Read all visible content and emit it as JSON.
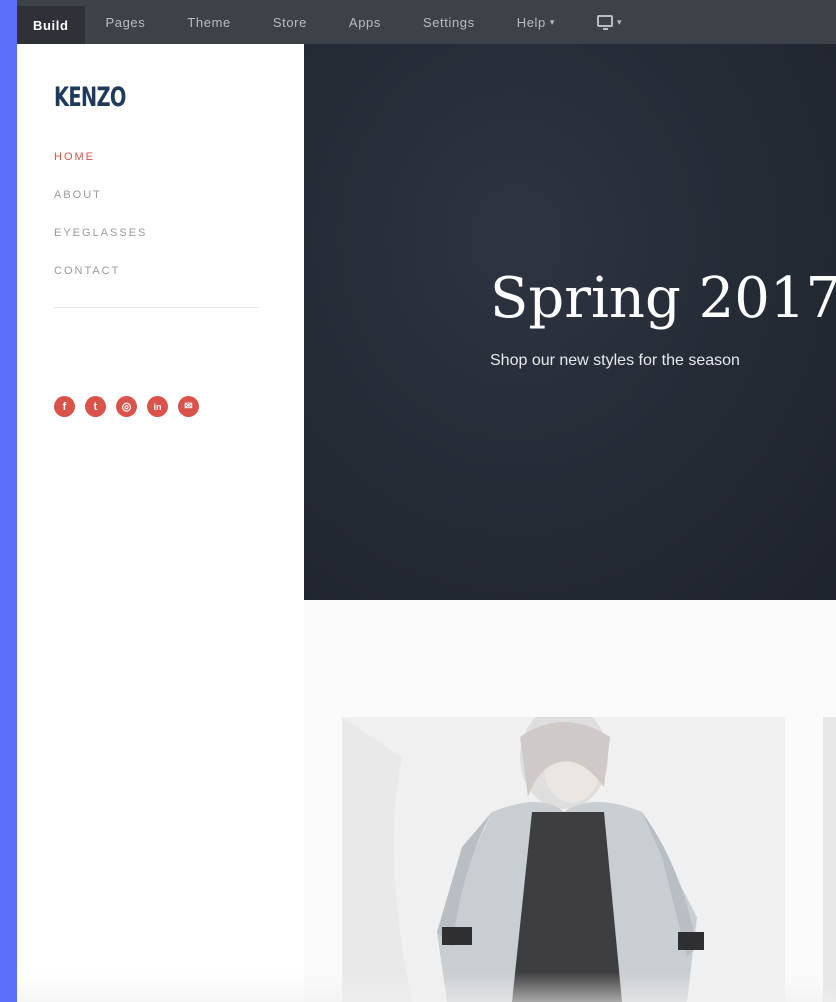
{
  "toolbar": {
    "tabs": [
      {
        "label": "Build"
      },
      {
        "label": "Pages"
      },
      {
        "label": "Theme"
      },
      {
        "label": "Store"
      },
      {
        "label": "Apps"
      },
      {
        "label": "Settings"
      },
      {
        "label": "Help"
      }
    ],
    "help_caret": "▾",
    "device_caret": "▾"
  },
  "site": {
    "brand": "KENZO",
    "nav": [
      {
        "label": "HOME",
        "active": true
      },
      {
        "label": "ABOUT",
        "active": false
      },
      {
        "label": "EYEGLASSES",
        "active": false
      },
      {
        "label": "CONTACT",
        "active": false
      }
    ],
    "social": [
      {
        "icon": "facebook-icon",
        "glyph": "f"
      },
      {
        "icon": "twitter-icon",
        "glyph": "t"
      },
      {
        "icon": "instagram-icon",
        "glyph": "◎"
      },
      {
        "icon": "linkedin-icon",
        "glyph": "in"
      },
      {
        "icon": "email-icon",
        "glyph": "✉"
      }
    ],
    "hero": {
      "title": "Spring 2017",
      "subtitle": "Shop our new styles for the season"
    }
  },
  "colors": {
    "accent": "#d9534a",
    "brand": "#1f3a5a",
    "toolbar_bg": "#3d4148",
    "hero_bg": "#252b35",
    "frame": "#5b6ff7"
  }
}
